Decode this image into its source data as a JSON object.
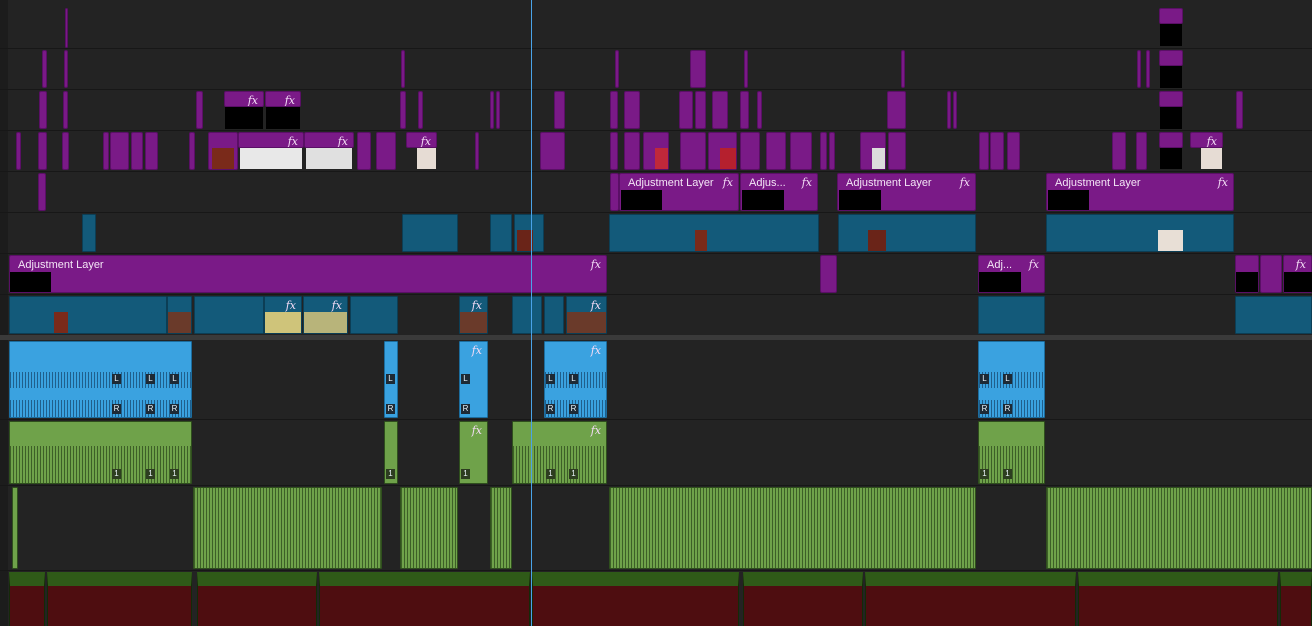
{
  "app": "Video editor timeline",
  "colors": {
    "video_adjust": "#7a1a87",
    "video_clip": "#135a7a",
    "audio_blue": "#3aa2e0",
    "audio_green": "#6fa24a",
    "music_body": "#4e0d10",
    "music_header": "#2f5a18",
    "playhead": "#4aa3e8"
  },
  "labels": {
    "adjustment_layer": "Adjustment Layer",
    "adjus_trunc": "Adjus...",
    "adj_trunc": "Adj...",
    "fx": "fx",
    "left_channel": "L",
    "right_channel": "R",
    "channel_one": "1",
    "music_note": "♫"
  },
  "icons": [
    "fx-badge-icon",
    "music-note-icon"
  ],
  "playhead_timecode": ""
}
